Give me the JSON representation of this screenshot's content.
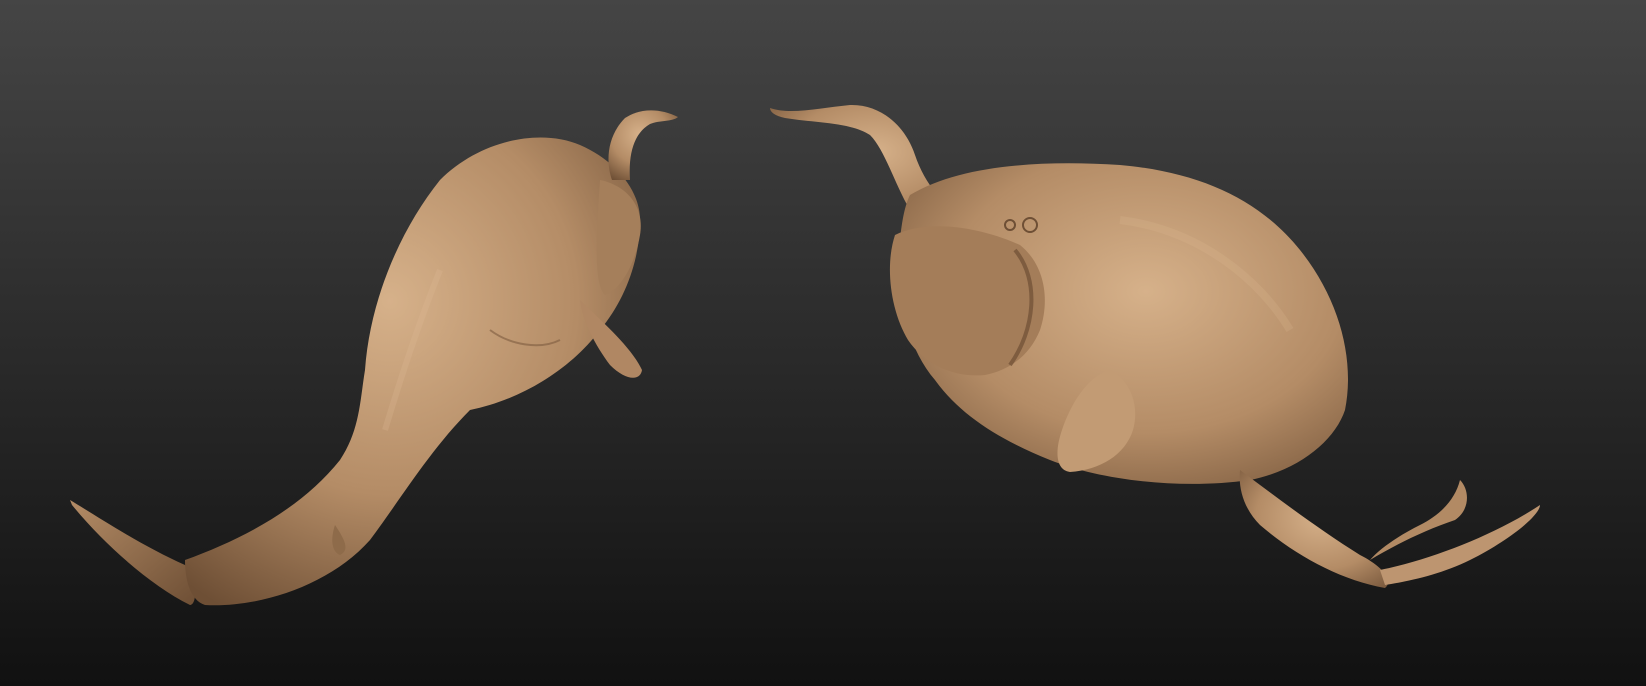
{
  "scene": {
    "background_top_color": "#454545",
    "background_bottom_color": "#111111",
    "clay_color": "#b48c66",
    "clay_shadow_color": "#6e4f35",
    "clay_highlight_color": "#d6b18a"
  },
  "figures": [
    {
      "name": "creature-left",
      "pose": "rear-dorsal-view"
    },
    {
      "name": "creature-right",
      "pose": "front-three-quarter-view"
    }
  ]
}
